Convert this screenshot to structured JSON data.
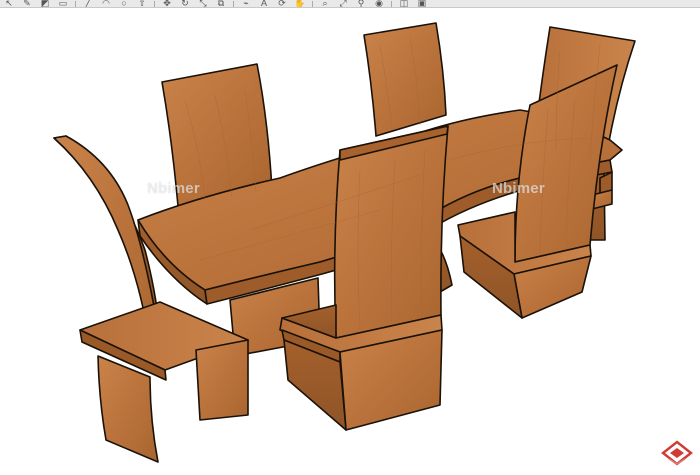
{
  "window": {
    "title": ""
  },
  "toolbar": {
    "tools": [
      "select-tool",
      "eraser-tool",
      "paint-tool",
      "rectangle-tool",
      "line-tool",
      "arc-tool",
      "circle-tool",
      "push-pull-tool",
      "move-tool",
      "rotate-tool",
      "scale-tool",
      "offset-tool",
      "tape-tool",
      "text-tool",
      "orbit-tool",
      "pan-tool",
      "zoom-tool",
      "zoom-extents-tool",
      "walk-tool",
      "look-tool",
      "section-tool",
      "paint-bucket-tool"
    ],
    "glyphs": [
      "↖",
      "✎",
      "◩",
      "▭",
      "╱",
      "◠",
      "○",
      "⇧",
      "✥",
      "↻",
      "⤡",
      "⧉",
      "⌁",
      "A",
      "⟳",
      "✋",
      "⌕",
      "⤢",
      "⚲",
      "◉",
      "◫",
      "▣"
    ]
  },
  "scene": {
    "model": "dining-table-set",
    "material": "wood",
    "colors": {
      "wood_light": "#c27a42",
      "wood_mid": "#b06a34",
      "wood_dark": "#8f5427",
      "edge": "#1a1208",
      "shadow": "#a45f2d"
    }
  },
  "watermarks": [
    {
      "text": "Nbimer"
    },
    {
      "text": "Nbimer"
    }
  ],
  "logo": {
    "icon": "site-logo-icon",
    "color": "#d23a36"
  }
}
